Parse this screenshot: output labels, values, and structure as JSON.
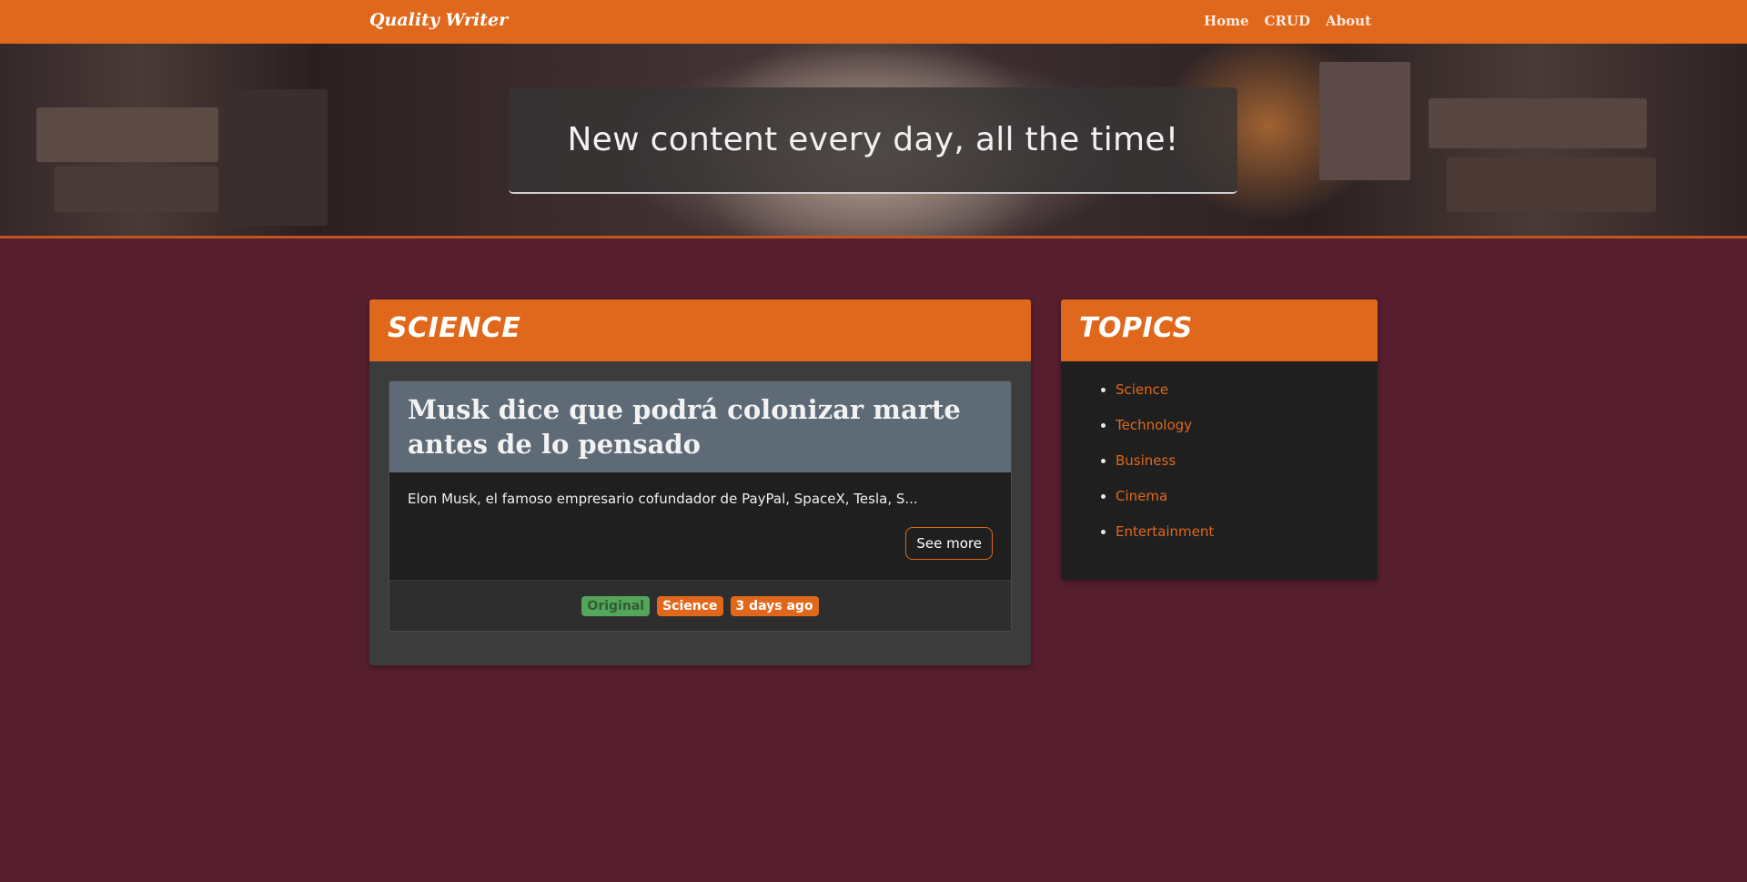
{
  "navbar": {
    "brand": "Quality Writer",
    "links": [
      "Home",
      "CRUD",
      "About"
    ]
  },
  "hero": {
    "headline": "New content every day, all the time!"
  },
  "science_section": {
    "title": "SCIENCE",
    "article": {
      "title": "Musk dice que podrá colonizar marte antes de lo pensado",
      "excerpt": "Elon Musk, el famoso empresario cofundador de PayPal, SpaceX, Tesla, S...",
      "see_more_label": "See more",
      "badges": [
        "Original",
        "Science",
        "3 days ago"
      ]
    }
  },
  "topics_section": {
    "title": "TOPICS",
    "items": [
      "Science",
      "Technology",
      "Business",
      "Cinema",
      "Entertainment"
    ]
  },
  "colors": {
    "accent": "#e0681c",
    "page_background": "#561e2e",
    "card_dark": "#1f1f1f",
    "article_header": "#5e6a76",
    "badge_green": "#54a65a"
  }
}
